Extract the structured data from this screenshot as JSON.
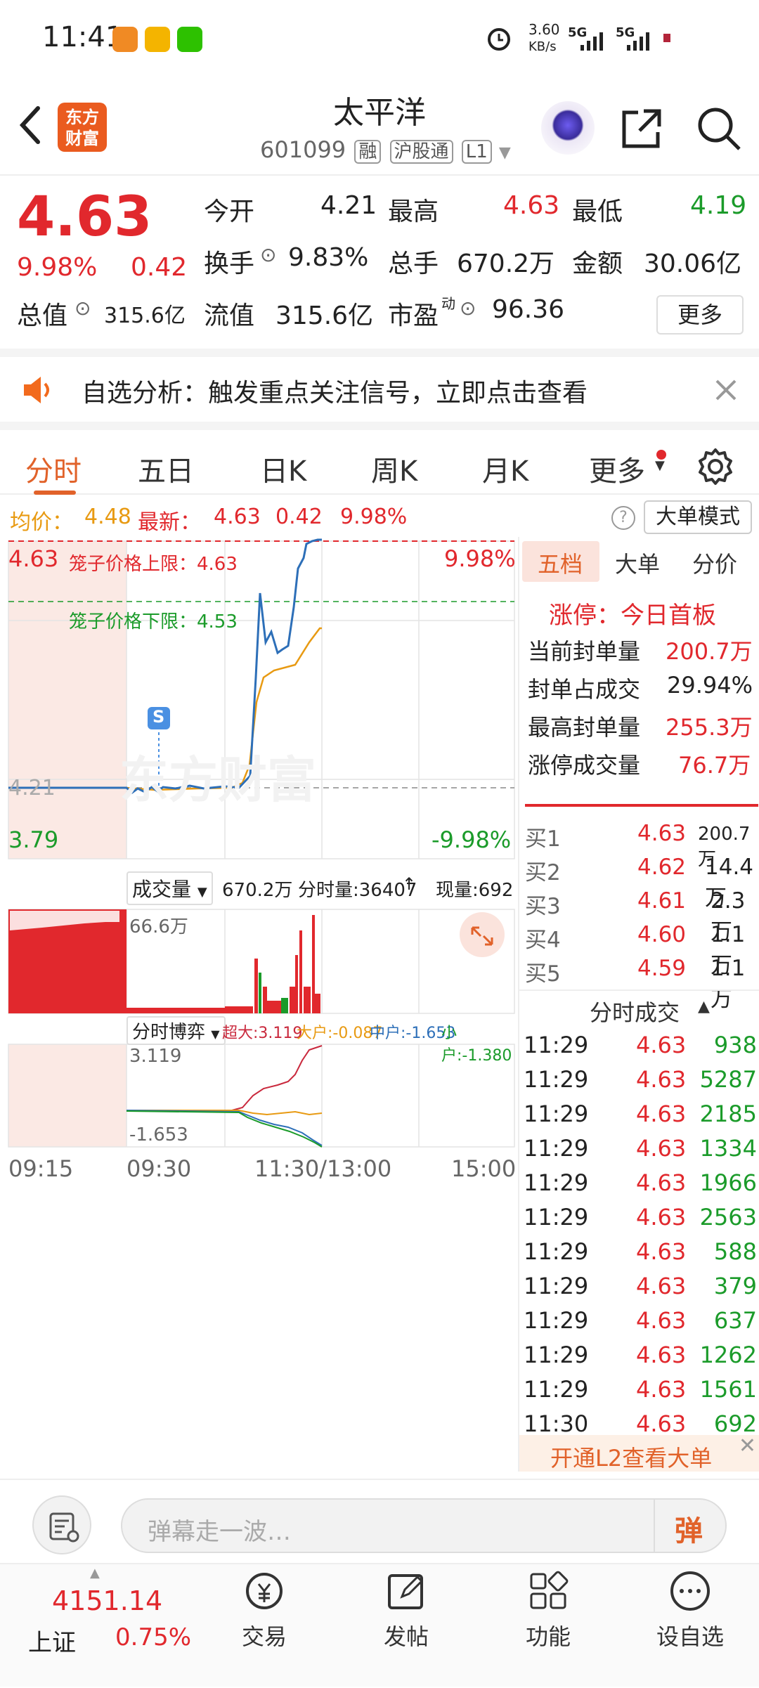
{
  "status_bar": {
    "time": "11:41",
    "net_speed": "3.60",
    "net_unit": "KB/s",
    "signal1": "5G",
    "signal2": "5G"
  },
  "header": {
    "logo_line1": "东方",
    "logo_line2": "财富",
    "title": "太平洋",
    "code": "601099",
    "tags": [
      "融",
      "沪股通",
      "L1"
    ]
  },
  "quote": {
    "price": "4.63",
    "change_pct": "9.98%",
    "change": "0.42",
    "open_label": "今开",
    "open": "4.21",
    "high_label": "最高",
    "high": "4.63",
    "low_label": "最低",
    "low": "4.19",
    "turnover_label": "换手",
    "turnover": "9.83%",
    "volume_label": "总手",
    "volume": "670.2万",
    "amount_label": "金额",
    "amount": "30.06亿",
    "mcap_label": "总值",
    "mcap": "315.6亿",
    "float_label": "流值",
    "float": "315.6亿",
    "pe_label": "市盈",
    "pe_sup": "动",
    "pe": "96.36",
    "more": "更多"
  },
  "notice": {
    "text": "自选分析：触发重点关注信号，立即点击查看"
  },
  "tabs": [
    "分时",
    "五日",
    "日K",
    "周K",
    "月K",
    "更多"
  ],
  "info_row": {
    "avg_label": "均价：",
    "avg": "4.48",
    "latest_label": "最新：",
    "latest": "4.63",
    "chg": "0.42",
    "pct": "9.98%",
    "mode_btn": "大单模式"
  },
  "chart": {
    "top_price": "4.63",
    "bottom_price": "3.79",
    "mid_price": "4.21",
    "top_pct": "9.98%",
    "bottom_pct": "-9.98%",
    "upper_limit_label": "笼子价格上限：4.63",
    "lower_limit_label": "笼子价格下限：4.53",
    "s_marker": "S",
    "watermark": "东方财富",
    "volume_label": "成交量",
    "volume_total": "670.2万",
    "volume_tick_label": "分时量:36407",
    "volume_now_label": "现量:692",
    "volume_max": "66.6万",
    "game_label": "分时博弈",
    "game_super": "超大:3.119",
    "game_big": "大户:-0.087",
    "game_mid": "中户:-1.653",
    "game_small": "小户:-1.380",
    "game_top": "3.119",
    "game_bottom": "-1.653",
    "time_labels": [
      "09:15",
      "09:30",
      "11:30/13:00",
      "15:00"
    ]
  },
  "right_panel": {
    "tabs": [
      "五档",
      "大单",
      "分价"
    ],
    "limit_title": "涨停：今日首板",
    "stats": [
      {
        "label": "当前封单量",
        "value": "200.7万"
      },
      {
        "label": "封单占成交",
        "value": "29.94%"
      },
      {
        "label": "最高封单量",
        "value": "255.3万"
      },
      {
        "label": "涨停成交量",
        "value": "76.7万"
      }
    ],
    "orderbook": [
      {
        "label": "买1",
        "price": "4.63",
        "vol": "200.7万"
      },
      {
        "label": "买2",
        "price": "4.62",
        "vol": "14.4万"
      },
      {
        "label": "买3",
        "price": "4.61",
        "vol": "2.3万"
      },
      {
        "label": "买4",
        "price": "4.60",
        "vol": "1.1万"
      },
      {
        "label": "买5",
        "price": "4.59",
        "vol": "1.1万"
      }
    ],
    "trades_title": "分时成交",
    "trades": [
      {
        "time": "11:29",
        "price": "4.63",
        "vol": "938"
      },
      {
        "time": "11:29",
        "price": "4.63",
        "vol": "5287"
      },
      {
        "time": "11:29",
        "price": "4.63",
        "vol": "2185"
      },
      {
        "time": "11:29",
        "price": "4.63",
        "vol": "1334"
      },
      {
        "time": "11:29",
        "price": "4.63",
        "vol": "1966"
      },
      {
        "time": "11:29",
        "price": "4.63",
        "vol": "2563"
      },
      {
        "time": "11:29",
        "price": "4.63",
        "vol": "588"
      },
      {
        "time": "11:29",
        "price": "4.63",
        "vol": "379"
      },
      {
        "time": "11:29",
        "price": "4.63",
        "vol": "637"
      },
      {
        "time": "11:29",
        "price": "4.63",
        "vol": "1262"
      },
      {
        "time": "11:29",
        "price": "4.63",
        "vol": "1561"
      },
      {
        "time": "11:30",
        "price": "4.63",
        "vol": "692"
      }
    ],
    "l2_banner": "开通L2查看大单"
  },
  "input_bar": {
    "placeholder": "弹幕走一波…",
    "send_label": "弹"
  },
  "bottom_nav": {
    "index_value": "4151.14",
    "index_name": "上证",
    "index_pct": "0.75%",
    "items": [
      "交易",
      "发帖",
      "功能",
      "设自选"
    ]
  },
  "colors": {
    "up": "#e1282d",
    "down": "#1b9b2a",
    "accent": "#e1622a",
    "avg_line": "#e89a12",
    "price_line": "#2d6fb8"
  }
}
